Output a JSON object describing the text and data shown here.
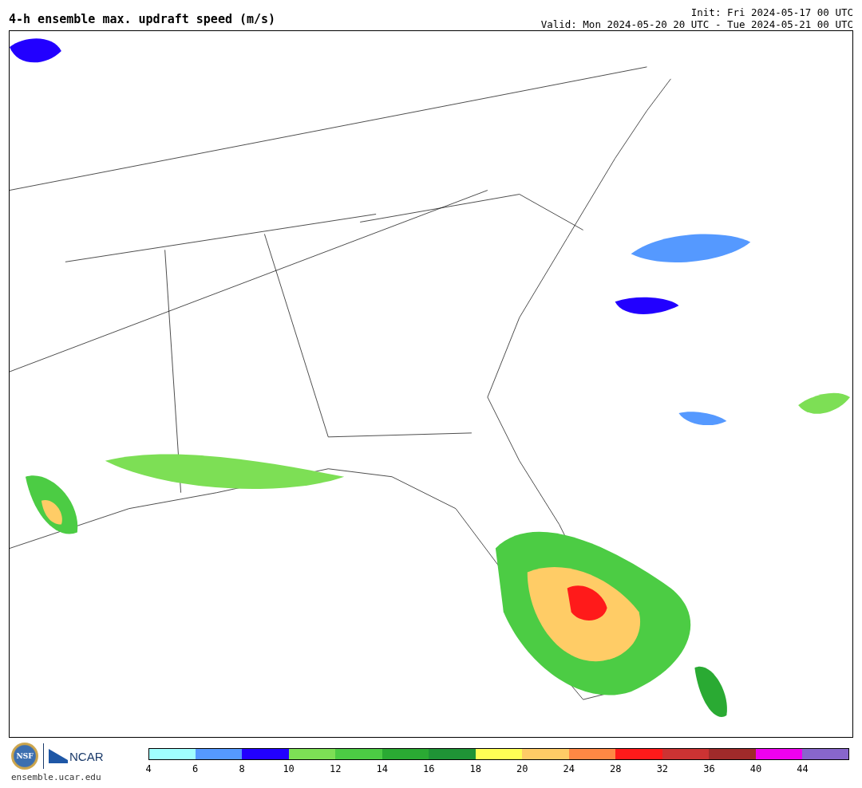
{
  "title": "4-h ensemble max. updraft speed (m/s)",
  "init": "Init: Fri 2024-05-17 00 UTC",
  "valid": "Valid: Mon 2024-05-20 20 UTC - Tue 2024-05-21 00 UTC",
  "logos": {
    "nsf": "NSF",
    "ncar": "NCAR",
    "url": "ensemble.ucar.edu"
  },
  "colorbar": [
    {
      "tick": "4",
      "color": "#a0ffff"
    },
    {
      "tick": "6",
      "color": "#5599ff"
    },
    {
      "tick": "8",
      "color": "#2200ff"
    },
    {
      "tick": "10",
      "color": "#7ddf55"
    },
    {
      "tick": "12",
      "color": "#4ccc44"
    },
    {
      "tick": "14",
      "color": "#2aaa33"
    },
    {
      "tick": "16",
      "color": "#1f9436"
    },
    {
      "tick": "18",
      "color": "#ffff55"
    },
    {
      "tick": "20",
      "color": "#ffcc66"
    },
    {
      "tick": "24",
      "color": "#ff8844"
    },
    {
      "tick": "28",
      "color": "#ff1a1a"
    },
    {
      "tick": "32",
      "color": "#cc3333"
    },
    {
      "tick": "36",
      "color": "#a02a2a"
    },
    {
      "tick": "40",
      "color": "#ee00ee"
    },
    {
      "tick": "44",
      "color": "#8866cc"
    }
  ]
}
